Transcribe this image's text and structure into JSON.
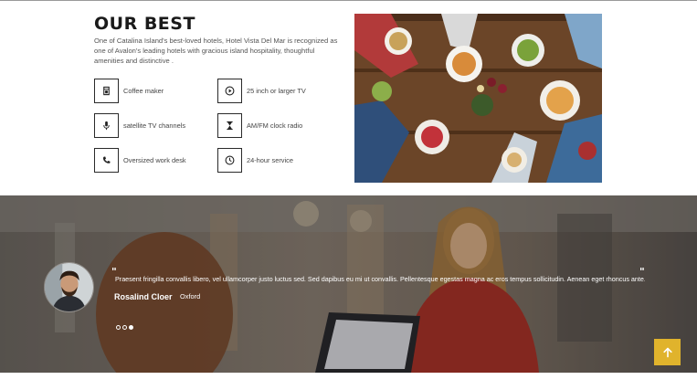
{
  "about": {
    "title": "OUR BEST",
    "description": "One of Catalina Island's best-loved hotels, Hotel Vista Del Mar is recognized as one of Avalon's leading hotels with gracious island hospitality, thoughtful amenities and distinctive ."
  },
  "amenities": [
    {
      "label": "Coffee maker",
      "icon": "coffee-maker-icon"
    },
    {
      "label": "25 inch or larger TV",
      "icon": "play-circle-icon"
    },
    {
      "label": "satellite TV channels",
      "icon": "microphone-icon"
    },
    {
      "label": "AM/FM clock radio",
      "icon": "hourglass-icon"
    },
    {
      "label": "Oversized work desk",
      "icon": "phone-icon"
    },
    {
      "label": "24-hour service",
      "icon": "clock-icon"
    }
  ],
  "testimonial": {
    "open_quote": "\"",
    "close_quote": "\"",
    "text": "Praesent fringilla convallis libero, vel ullamcorper justo luctus sed. Sed dapibus eu mi ut convallis. Pellentesque egestas magna ac eros tempus sollicitudin. Aenean eget rhoncus ante.",
    "author": "Rosalind Cloer",
    "city": "Oxford",
    "slides": 3,
    "active_slide": 3
  },
  "colors": {
    "accent": "#e0b32c",
    "text_dark": "#1a1a1a",
    "text_muted": "#555555"
  },
  "icons": {
    "scroll_top": "arrow-up-icon"
  }
}
